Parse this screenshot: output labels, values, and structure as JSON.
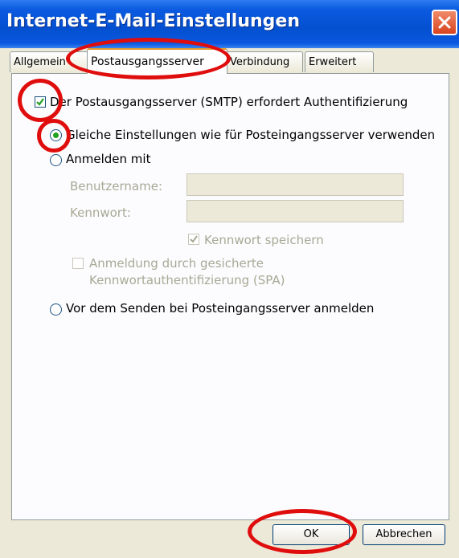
{
  "window": {
    "title": "Internet-E-Mail-Einstellungen",
    "close_icon": "close-icon"
  },
  "tabs": [
    {
      "label": "Allgemein",
      "selected": false
    },
    {
      "label": "Postausgangsserver",
      "selected": true
    },
    {
      "label": "Verbindung",
      "selected": false
    },
    {
      "label": "Erweitert",
      "selected": false
    }
  ],
  "smtp_auth": {
    "label": "Der Postausgangsserver (SMTP) erfordert Authentifizierung",
    "checked": true
  },
  "options": {
    "same_settings": {
      "label": "Gleiche Einstellungen wie für Posteingangsserver verwenden",
      "selected": true
    },
    "login_with": {
      "label": "Anmelden mit",
      "selected": false
    },
    "username_label": "Benutzername:",
    "username_value": "",
    "password_label": "Kennwort:",
    "password_value": "",
    "save_password": {
      "label": "Kennwort speichern",
      "checked": true,
      "disabled": true
    },
    "spa": {
      "label_line1": "Anmeldung durch gesicherte",
      "label_line2": "Kennwortauthentifizierung (SPA)",
      "checked": false,
      "disabled": true
    },
    "before_send": {
      "label": "Vor dem Senden bei Posteingangsserver anmelden",
      "selected": false
    }
  },
  "buttons": {
    "ok": "OK",
    "cancel": "Abbrechen"
  },
  "colors": {
    "titlebar": "#0450d0",
    "annotation_ring": "#e00d0d",
    "check_mark": "#21a121",
    "radio_dot": "#21a121"
  }
}
